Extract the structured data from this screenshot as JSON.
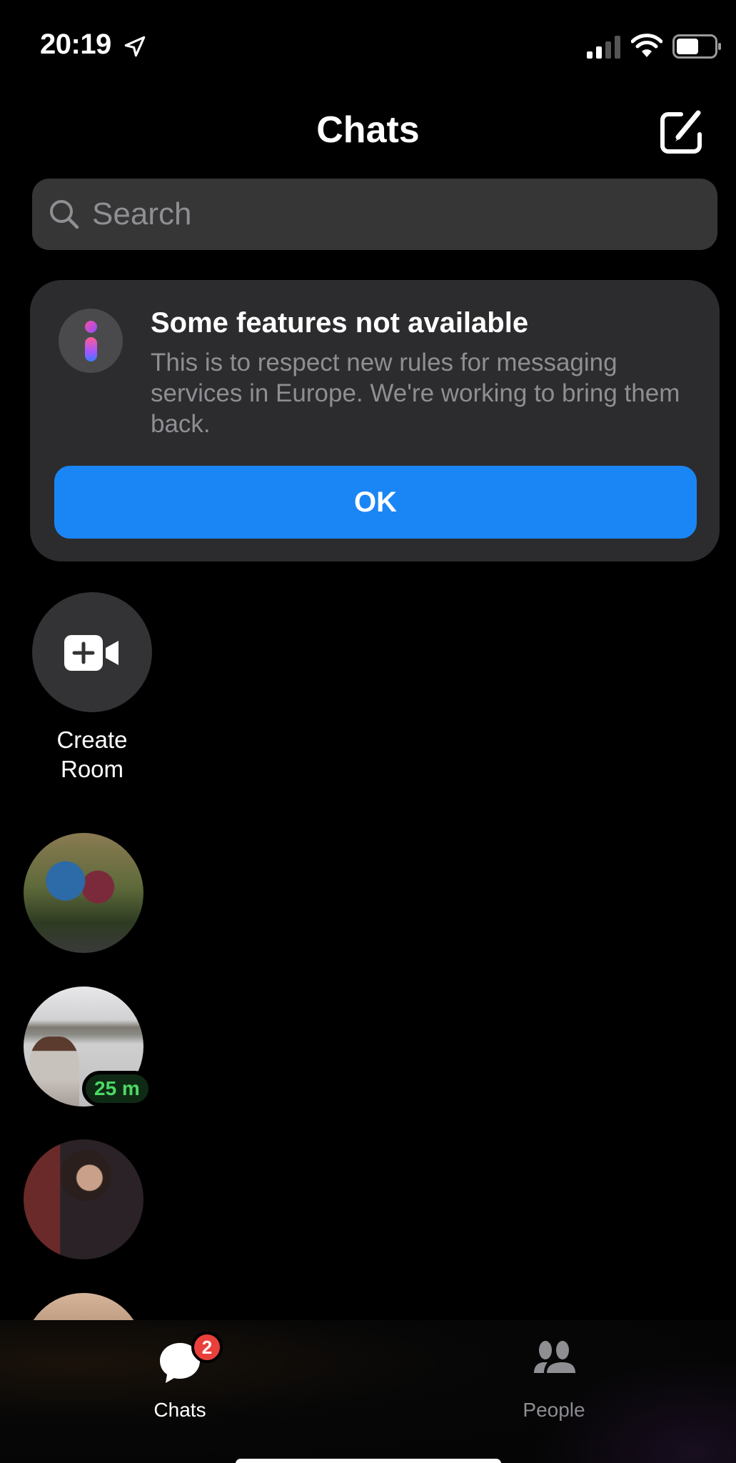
{
  "status_bar": {
    "time": "20:19",
    "location_icon": "location-arrow-icon",
    "signal_icon": "cellular-signal-icon",
    "signal_bars_active": 2,
    "signal_bars_total": 4,
    "wifi_icon": "wifi-icon",
    "battery_icon": "battery-icon",
    "battery_level": 0.6
  },
  "header": {
    "title": "Chats",
    "compose_icon": "compose-icon"
  },
  "search": {
    "placeholder": "Search",
    "value": "",
    "icon": "search-icon"
  },
  "notice": {
    "icon": "info-icon",
    "title": "Some features not available",
    "body": "This is to respect new rules for messaging services in Europe. We're working to bring them back.",
    "button_label": "OK",
    "button_color": "#1a86f5"
  },
  "create_room": {
    "icon": "video-plus-icon",
    "label": "Create Room"
  },
  "chats": [
    {
      "avatar": "photo-two-people",
      "active_badge": null
    },
    {
      "avatar": "photo-man-by-river",
      "active_badge": "25 m"
    },
    {
      "avatar": "photo-woman-with-drink",
      "active_badge": null
    },
    {
      "avatar": "photo-partial",
      "active_badge": null
    }
  ],
  "tab_bar": {
    "tabs": [
      {
        "label": "Chats",
        "icon": "chat-bubble-icon",
        "selected": true,
        "badge": "2"
      },
      {
        "label": "People",
        "icon": "people-icon",
        "selected": false,
        "badge": null
      }
    ]
  },
  "colors": {
    "accent": "#1a86f5",
    "badge_red": "#e9403c",
    "active_green": "#4cd964",
    "background": "#000000",
    "card": "#2c2c2e"
  }
}
